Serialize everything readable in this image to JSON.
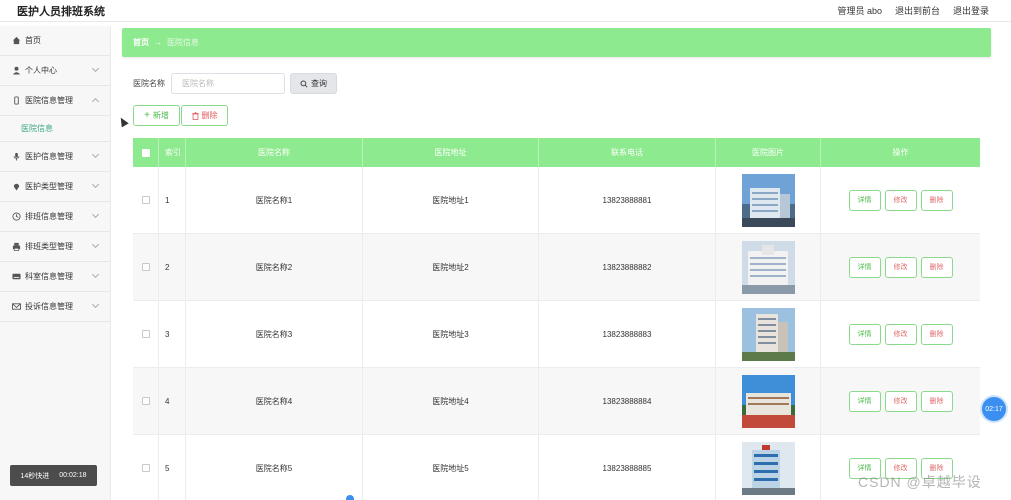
{
  "header": {
    "app_title": "医护人员排班系统",
    "user_label": "管理员 abo",
    "front_link": "退出到前台",
    "logout_link": "退出登录"
  },
  "sidebar": {
    "items": [
      {
        "label": "首页",
        "icon": "home-icon",
        "expandable": false
      },
      {
        "label": "个人中心",
        "icon": "user-icon",
        "expandable": true
      },
      {
        "label": "医院信息管理",
        "icon": "phone-icon",
        "expandable": true,
        "expanded": true
      },
      {
        "label": "医护信息管理",
        "icon": "mic-icon",
        "expandable": true
      },
      {
        "label": "医护类型管理",
        "icon": "pin-icon",
        "expandable": true
      },
      {
        "label": "排班信息管理",
        "icon": "clock-icon",
        "expandable": true
      },
      {
        "label": "排班类型管理",
        "icon": "printer-icon",
        "expandable": true
      },
      {
        "label": "科室信息管理",
        "icon": "keyboard-icon",
        "expandable": true
      },
      {
        "label": "投诉信息管理",
        "icon": "mail-icon",
        "expandable": true
      }
    ],
    "submenu_active": "医院信息",
    "timer": {
      "left": "14秒快进",
      "right": "00:02:18"
    }
  },
  "breadcrumb": {
    "home": "首页",
    "separator": "→",
    "current": "医院信息"
  },
  "search": {
    "label": "医院名称",
    "placeholder": "医院名称",
    "value": "",
    "button": "查询"
  },
  "actions": {
    "add": "新增",
    "delete": "删除"
  },
  "table": {
    "columns": [
      "索引",
      "医院名称",
      "医院地址",
      "联系电话",
      "医院图片",
      "操作"
    ],
    "rows": [
      {
        "index": "1",
        "name": "医院名称1",
        "address": "医院地址1",
        "phone": "13823888881"
      },
      {
        "index": "2",
        "name": "医院名称2",
        "address": "医院地址2",
        "phone": "13823888882"
      },
      {
        "index": "3",
        "name": "医院名称3",
        "address": "医院地址3",
        "phone": "13823888883"
      },
      {
        "index": "4",
        "name": "医院名称4",
        "address": "医院地址4",
        "phone": "13823888884"
      },
      {
        "index": "5",
        "name": "医院名称5",
        "address": "医院地址5",
        "phone": "13823888885"
      }
    ],
    "row_actions": {
      "detail": "详情",
      "edit": "修改",
      "remove": "删除"
    }
  },
  "float_badge": "02:17",
  "watermark": "CSDN @卓越毕设",
  "colors": {
    "accent_green": "#8eea8e",
    "button_green": "#4dbb4d",
    "danger_red": "#e06c6c",
    "badge_blue": "#3b8ff0"
  }
}
